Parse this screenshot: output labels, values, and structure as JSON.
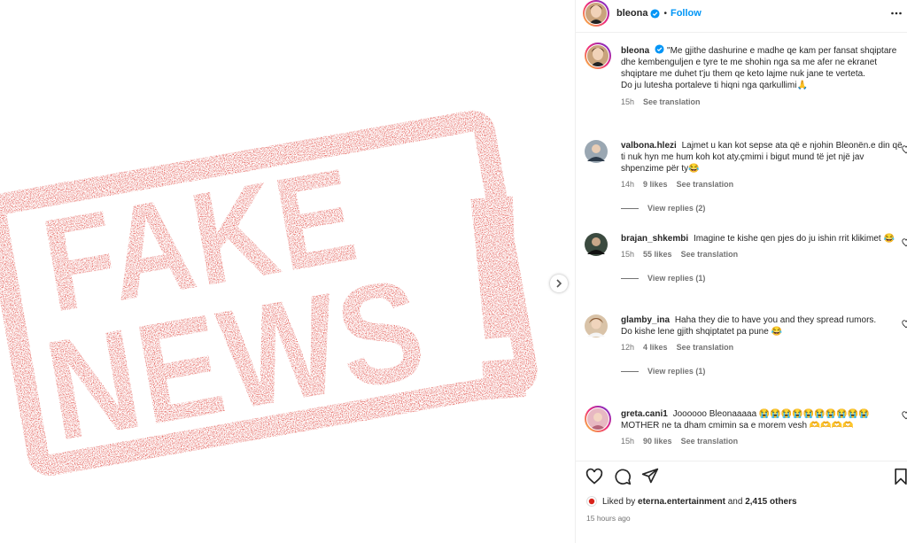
{
  "post": {
    "username": "bleona",
    "follow_label": "Follow",
    "separator": "•",
    "caption": "\"Me gjithe dashurine e madhe qe kam per fansat shqiptare dhe kembenguljen e tyre te me shohin nga sa me afer ne ekranet shqiptare me duhet t'ju them qe keto lajme nuk jane te verteta.",
    "caption_line2": "Do ju lutesha portaleve ti hiqni nga qarkullimi",
    "caption_emoji": "🙏",
    "caption_time": "15h",
    "see_translation": "See translation"
  },
  "media": {
    "stamp_word1": "FAKE",
    "stamp_word2": "NEWS",
    "stamp_mark": "!",
    "accent": "#d8231b"
  },
  "comments": [
    {
      "username": "valbona.hlezi",
      "text": "Lajmet u kan kot sepse ata që e njohin Bleonën.e din që ti nuk hyn me hum koh kot aty.çmimi i bigut mund të jet një jav shpenzime për ty",
      "emoji": "😂",
      "time": "14h",
      "likes": "9 likes",
      "see_translation": "See translation",
      "view_replies": "View replies (2)"
    },
    {
      "username": "brajan_shkembi",
      "text": "Imagine te kishe qen pjes do ju ishin rrit klikimet",
      "emoji": "😂",
      "time": "15h",
      "likes": "55 likes",
      "see_translation": "See translation",
      "view_replies": "View replies (1)"
    },
    {
      "username": "glamby_ina",
      "text": "Haha they die to have you and they spread rumors.",
      "text2": "Do kishe lene gjith shqiptatet pa pune",
      "emoji": "😂",
      "time": "12h",
      "likes": "4 likes",
      "see_translation": "See translation",
      "view_replies": "View replies (1)"
    },
    {
      "username": "greta.cani1",
      "text": "Joooooo Bleonaaaaa 😭😭😭😭😭😭😭😭😭😭 MOTHER ne ta dham cmimin sa e morem vesh 🫶🫶🫶🫶",
      "time": "15h",
      "likes": "90 likes",
      "see_translation": "See translation"
    }
  ],
  "footer": {
    "liked_by_prefix": "Liked by",
    "liked_by_user": "eterna.entertainment",
    "liked_by_and": "and",
    "liked_by_others": "2,415 others",
    "posted_time": "15 hours ago"
  },
  "icons": {
    "verified": "verified-badge-icon",
    "more": "more-options-icon",
    "heart": "heart-icon",
    "comment": "comment-icon",
    "share": "share-icon",
    "save": "bookmark-icon",
    "next": "chevron-right-icon"
  }
}
